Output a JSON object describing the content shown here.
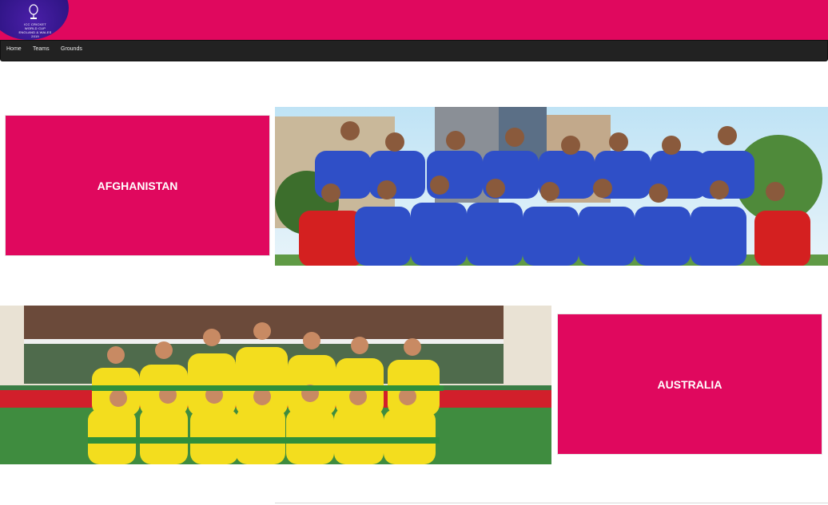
{
  "header": {
    "brand_color": "#e0085e",
    "logo_text": "ICC CRICKET WORLD CUP ENGLAND & WALES 2019"
  },
  "nav": {
    "items": [
      {
        "label": "Home"
      },
      {
        "label": "Teams"
      },
      {
        "label": "Grounds"
      }
    ]
  },
  "teams": [
    {
      "name": "AFGHANISTAN",
      "jersey_color": "#2f4fc7",
      "photo_icon": "team-photo"
    },
    {
      "name": "AUSTRALIA",
      "jersey_color": "#f3dd1e",
      "photo_icon": "team-photo"
    }
  ]
}
